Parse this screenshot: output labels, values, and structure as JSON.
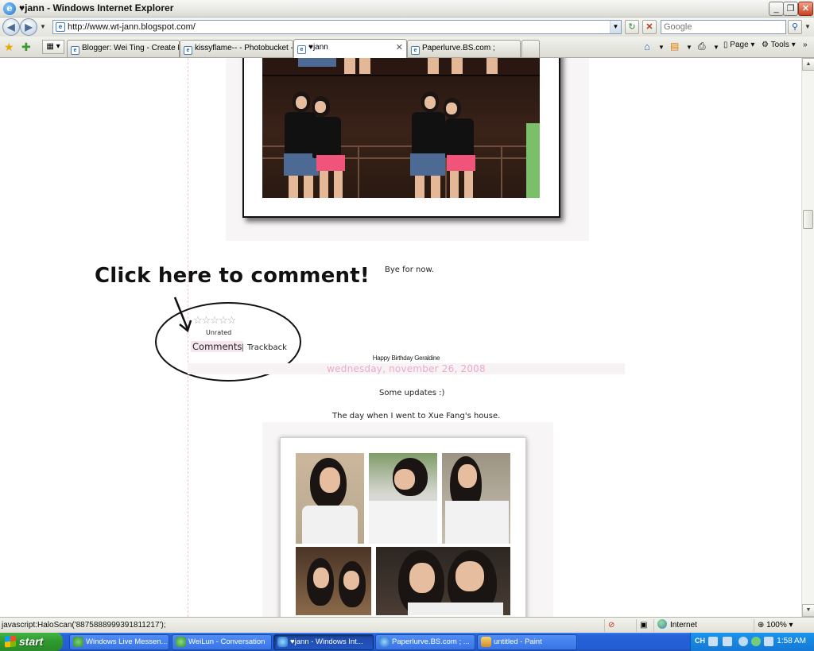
{
  "window": {
    "title": "♥jann - Windows Internet Explorer",
    "minimize": "_",
    "restore": "❐",
    "close": "✕"
  },
  "address_bar": {
    "url": "http://www.wt-jann.blogspot.com/",
    "search_placeholder": "Google",
    "refresh_glyph": "↻",
    "stop_glyph": "✕",
    "search_glyph": "⚲"
  },
  "tabs": [
    {
      "label": "Blogger: Wei Ting - Create Post",
      "active": false
    },
    {
      "label": "kissyflame-- - Photobucket - ...",
      "active": false
    },
    {
      "label": "♥jann",
      "active": true
    },
    {
      "label": "Paperlurve.BS.com ;",
      "active": false
    }
  ],
  "command_bar": {
    "page_label": "Page",
    "tools_label": "Tools"
  },
  "post1": {
    "footer_text": "Bye for now.",
    "rating_stars": "☆☆☆☆☆",
    "rating_label": "Unrated",
    "comments_label": "Comments",
    "separator": "|",
    "trackback_label": "Trackback"
  },
  "annotation": {
    "text": "Click here to comment!"
  },
  "post2": {
    "title": "Happy Birthday Geraldine",
    "date": "wednesday, november 26, 2008",
    "line1": "Some updates :)",
    "line2": "The day when I went to Xue Fang's house."
  },
  "status_bar": {
    "text": "javascript:HaloScan('8875888999391811217');",
    "zone": "Internet",
    "zoom": "100%"
  },
  "taskbar": {
    "start_label": "start",
    "items": [
      {
        "label": "Windows Live Messen...",
        "active": false
      },
      {
        "label": "WeiLun - Conversation",
        "active": false
      },
      {
        "label": "♥jann - Windows Int...",
        "active": true
      },
      {
        "label": "Paperlurve.BS.com ; ...",
        "active": false
      },
      {
        "label": "untitled - Paint",
        "active": false
      }
    ],
    "tray_language": "CH",
    "clock": "1:58 AM"
  }
}
